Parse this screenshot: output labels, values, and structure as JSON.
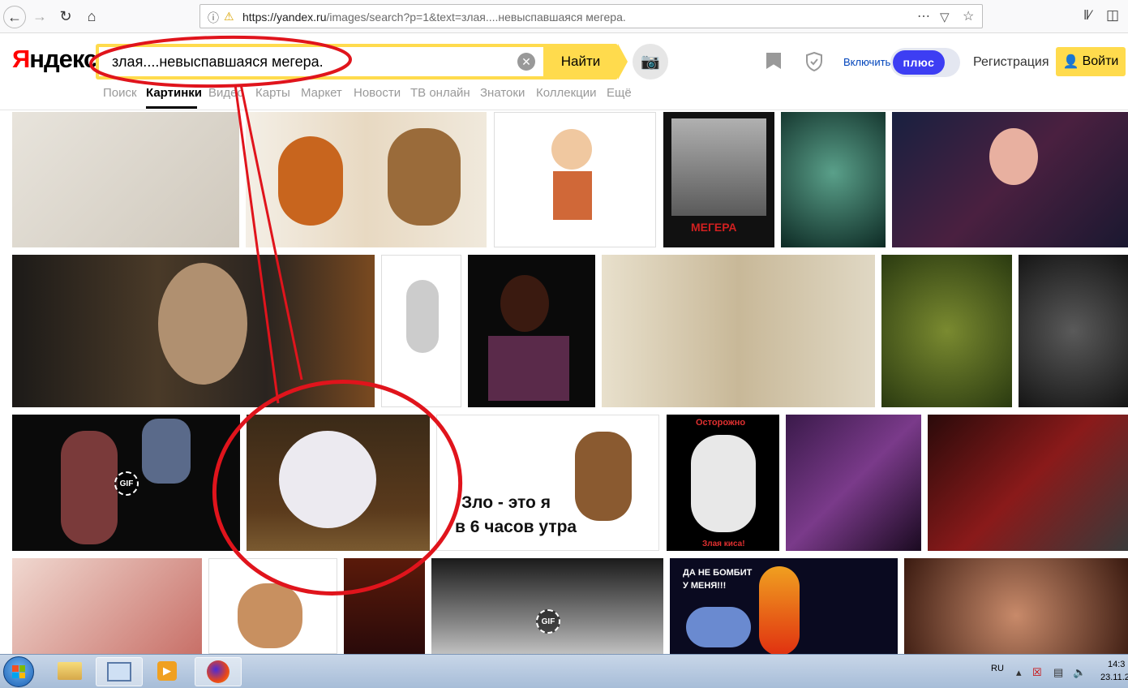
{
  "browser": {
    "url_host": "https://yandex.ru",
    "url_rest": "/images/search?p=1&text=злая....невыспавшаяся мегера.",
    "icons": [
      "back-icon",
      "forward-icon",
      "reload-icon",
      "home-icon",
      "info-icon",
      "insecure-lock-icon",
      "more-icon",
      "pocket-icon",
      "star-icon",
      "library-icon",
      "sidebar-icon",
      "menu-icon"
    ]
  },
  "header": {
    "logo_first": "Я",
    "logo_rest": "ндекс",
    "search_value": "злая....невыспавшаяся мегера.",
    "search_button": "Найти",
    "enable_label": "Включить",
    "plus_label": "плюс",
    "register_label": "Регистрация",
    "login_label": "Войти"
  },
  "tabs": [
    {
      "label": "Поиск",
      "active": false
    },
    {
      "label": "Картинки",
      "active": true
    },
    {
      "label": "Видео",
      "active": false
    },
    {
      "label": "Карты",
      "active": false
    },
    {
      "label": "Маркет",
      "active": false
    },
    {
      "label": "Новости",
      "active": false
    },
    {
      "label": "ТВ онлайн",
      "active": false
    },
    {
      "label": "Знатоки",
      "active": false
    },
    {
      "label": "Коллекции",
      "active": false
    },
    {
      "label": "Ещё",
      "active": false
    }
  ],
  "images": {
    "gif_label": "GIF",
    "megera_caption": "МЕГЕРА",
    "owl_caption_1": "Зло - это я",
    "owl_caption_2": "в 6 часов утра",
    "cat_caption_top": "Осторожно",
    "cat_caption_bottom": "Злая киса!",
    "hades_caption_1": "ДА НЕ БОМБИТ",
    "hades_caption_2": "У МЕНЯ!!!"
  },
  "taskbar": {
    "lang": "RU",
    "time": "14:3",
    "date": "23.11.2"
  },
  "colors": {
    "yandex_yellow": "#ffdb4d",
    "yandex_red": "#ff0000",
    "plus_blue": "#3d3ef3",
    "annotation_red": "#e0141c"
  }
}
